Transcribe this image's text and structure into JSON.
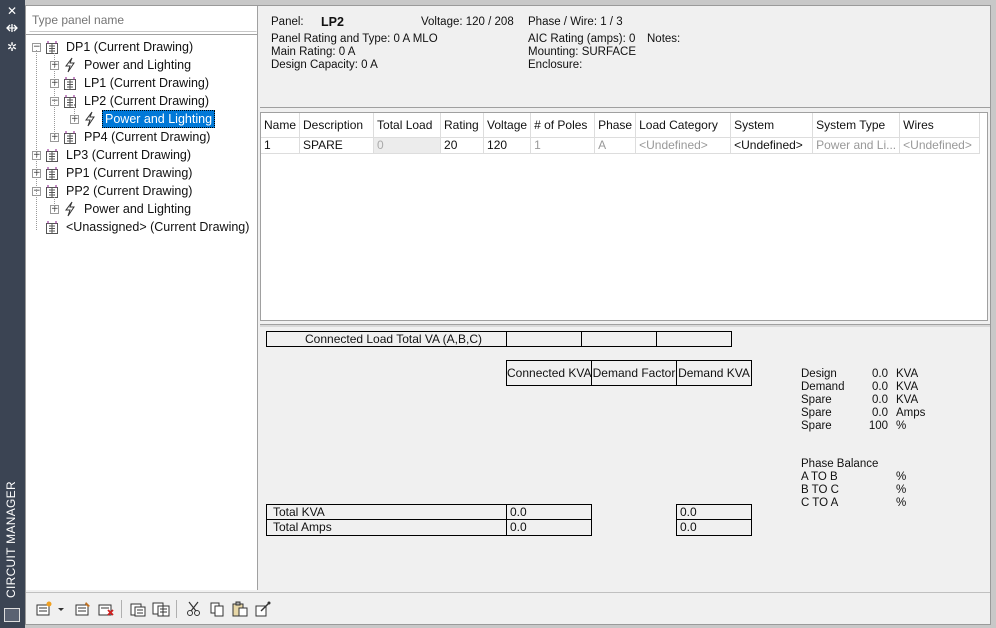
{
  "palette": {
    "title": "CIRCUIT MANAGER",
    "close_icon": "close-icon",
    "pin_icon": "auto-hide-icon",
    "settings_icon": "properties-icon"
  },
  "tree": {
    "search_placeholder": "Type panel name",
    "nodes": [
      {
        "label": "DP1 (Current Drawing)",
        "icon": "panel-icon",
        "level": 0,
        "expander": "-"
      },
      {
        "label": "Power and Lighting",
        "icon": "lightning-icon",
        "level": 1,
        "expander": "+"
      },
      {
        "label": "LP1 (Current Drawing)",
        "icon": "panel-icon",
        "level": 1,
        "expander": "+"
      },
      {
        "label": "LP2 (Current Drawing)",
        "icon": "panel-icon",
        "level": 1,
        "expander": "-"
      },
      {
        "label": "Power and Lighting",
        "icon": "lightning-icon",
        "level": 2,
        "expander": "+",
        "selected": true
      },
      {
        "label": "PP4 (Current Drawing)",
        "icon": "panel-icon",
        "level": 1,
        "expander": "+"
      },
      {
        "label": "LP3 (Current Drawing)",
        "icon": "panel-icon",
        "level": 0,
        "expander": "+"
      },
      {
        "label": "PP1 (Current Drawing)",
        "icon": "panel-icon",
        "level": 0,
        "expander": "+"
      },
      {
        "label": "PP2 (Current Drawing)",
        "icon": "panel-icon",
        "level": 0,
        "expander": "-"
      },
      {
        "label": "Power and Lighting",
        "icon": "lightning-icon",
        "level": 1,
        "expander": "+"
      },
      {
        "label": "<Unassigned> (Current Drawing)",
        "icon": "panel-icon",
        "level": 0,
        "expander": ""
      }
    ]
  },
  "info": {
    "panel_label": "Panel:",
    "panel_value": "LP2",
    "voltage": "Voltage: 120 / 208",
    "phase_wire": "Phase / Wire:   1 /  3",
    "rating_type": "Panel Rating and Type: 0 A MLO",
    "aic": "AIC Rating (amps):   0",
    "notes": "Notes:",
    "main_rating": "Main Rating: 0 A",
    "mounting": "Mounting: SURFACE",
    "design_capacity": "Design Capacity: 0 A",
    "enclosure": "Enclosure:"
  },
  "grid": {
    "columns": [
      "Name",
      "Description",
      "Total Load",
      "Rating",
      "Voltage",
      "# of Poles",
      "Phase",
      "Load Category",
      "System",
      "System Type",
      "Wires"
    ],
    "rows": [
      [
        "1",
        "SPARE",
        "0",
        "20",
        "120",
        "1",
        "A",
        "<Undefined>",
        "<Undefined>",
        "Power and Li...",
        "<Undefined>"
      ]
    ]
  },
  "summary": {
    "connected_load_label": "Connected Load Total VA (A,B,C)",
    "connected_kva": "Connected KVA",
    "demand_factor": "Demand Factor",
    "demand_kva": "Demand KVA",
    "total_kva_label": "Total KVA",
    "total_kva_value": "0.0",
    "total_kva_demand": "0.0",
    "total_amps_label": "Total Amps",
    "total_amps_value": "0.0",
    "total_amps_demand": "0.0",
    "stats": [
      {
        "label": "Design",
        "value": "0.0",
        "unit": "KVA"
      },
      {
        "label": "Demand",
        "value": "0.0",
        "unit": "KVA"
      },
      {
        "label": "Spare",
        "value": "0.0",
        "unit": "KVA"
      },
      {
        "label": "Spare",
        "value": "0.0",
        "unit": "Amps"
      },
      {
        "label": "Spare",
        "value": "100",
        "unit": "%"
      }
    ],
    "phase_balance_title": "Phase Balance",
    "phase_balance": [
      {
        "label": "A TO B",
        "unit": "%"
      },
      {
        "label": "B TO C",
        "unit": "%"
      },
      {
        "label": "C TO A",
        "unit": "%"
      }
    ]
  },
  "toolbar": {
    "buttons": [
      "new-panel-icon",
      "dropdown-arrow-icon",
      "panel-properties-icon",
      "delete-panel-icon",
      "copy-panel-icon",
      "panel-schedule-icon",
      "cut-icon",
      "copy-icon",
      "paste-icon",
      "wire-icon"
    ]
  }
}
